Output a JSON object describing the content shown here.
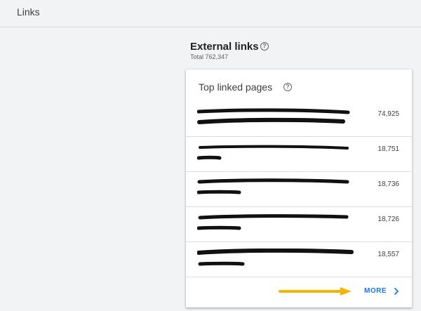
{
  "header": {
    "title": "Links"
  },
  "external_links": {
    "title": "External links",
    "total_text": "Total 762,347",
    "help_icon": "help-circle-icon"
  },
  "top_linked_pages": {
    "title": "Top linked pages",
    "help_icon": "help-circle-icon",
    "rows": [
      {
        "url_text": "",
        "count": "74,925",
        "redacted": true
      },
      {
        "url_text": "",
        "count": "18,751",
        "redacted": true
      },
      {
        "url_text": "",
        "count": "18,736",
        "redacted": true
      },
      {
        "url_text": "",
        "count": "18,726",
        "redacted": true
      },
      {
        "url_text": "",
        "count": "18,557",
        "redacted": true
      }
    ],
    "more_label": "MORE",
    "more_icon": "chevron-right-icon"
  },
  "annotations": {
    "arrow_color": "#f4b400"
  },
  "colors": {
    "background": "#f1f3f4",
    "card": "#ffffff",
    "accent": "#1a73e8"
  }
}
